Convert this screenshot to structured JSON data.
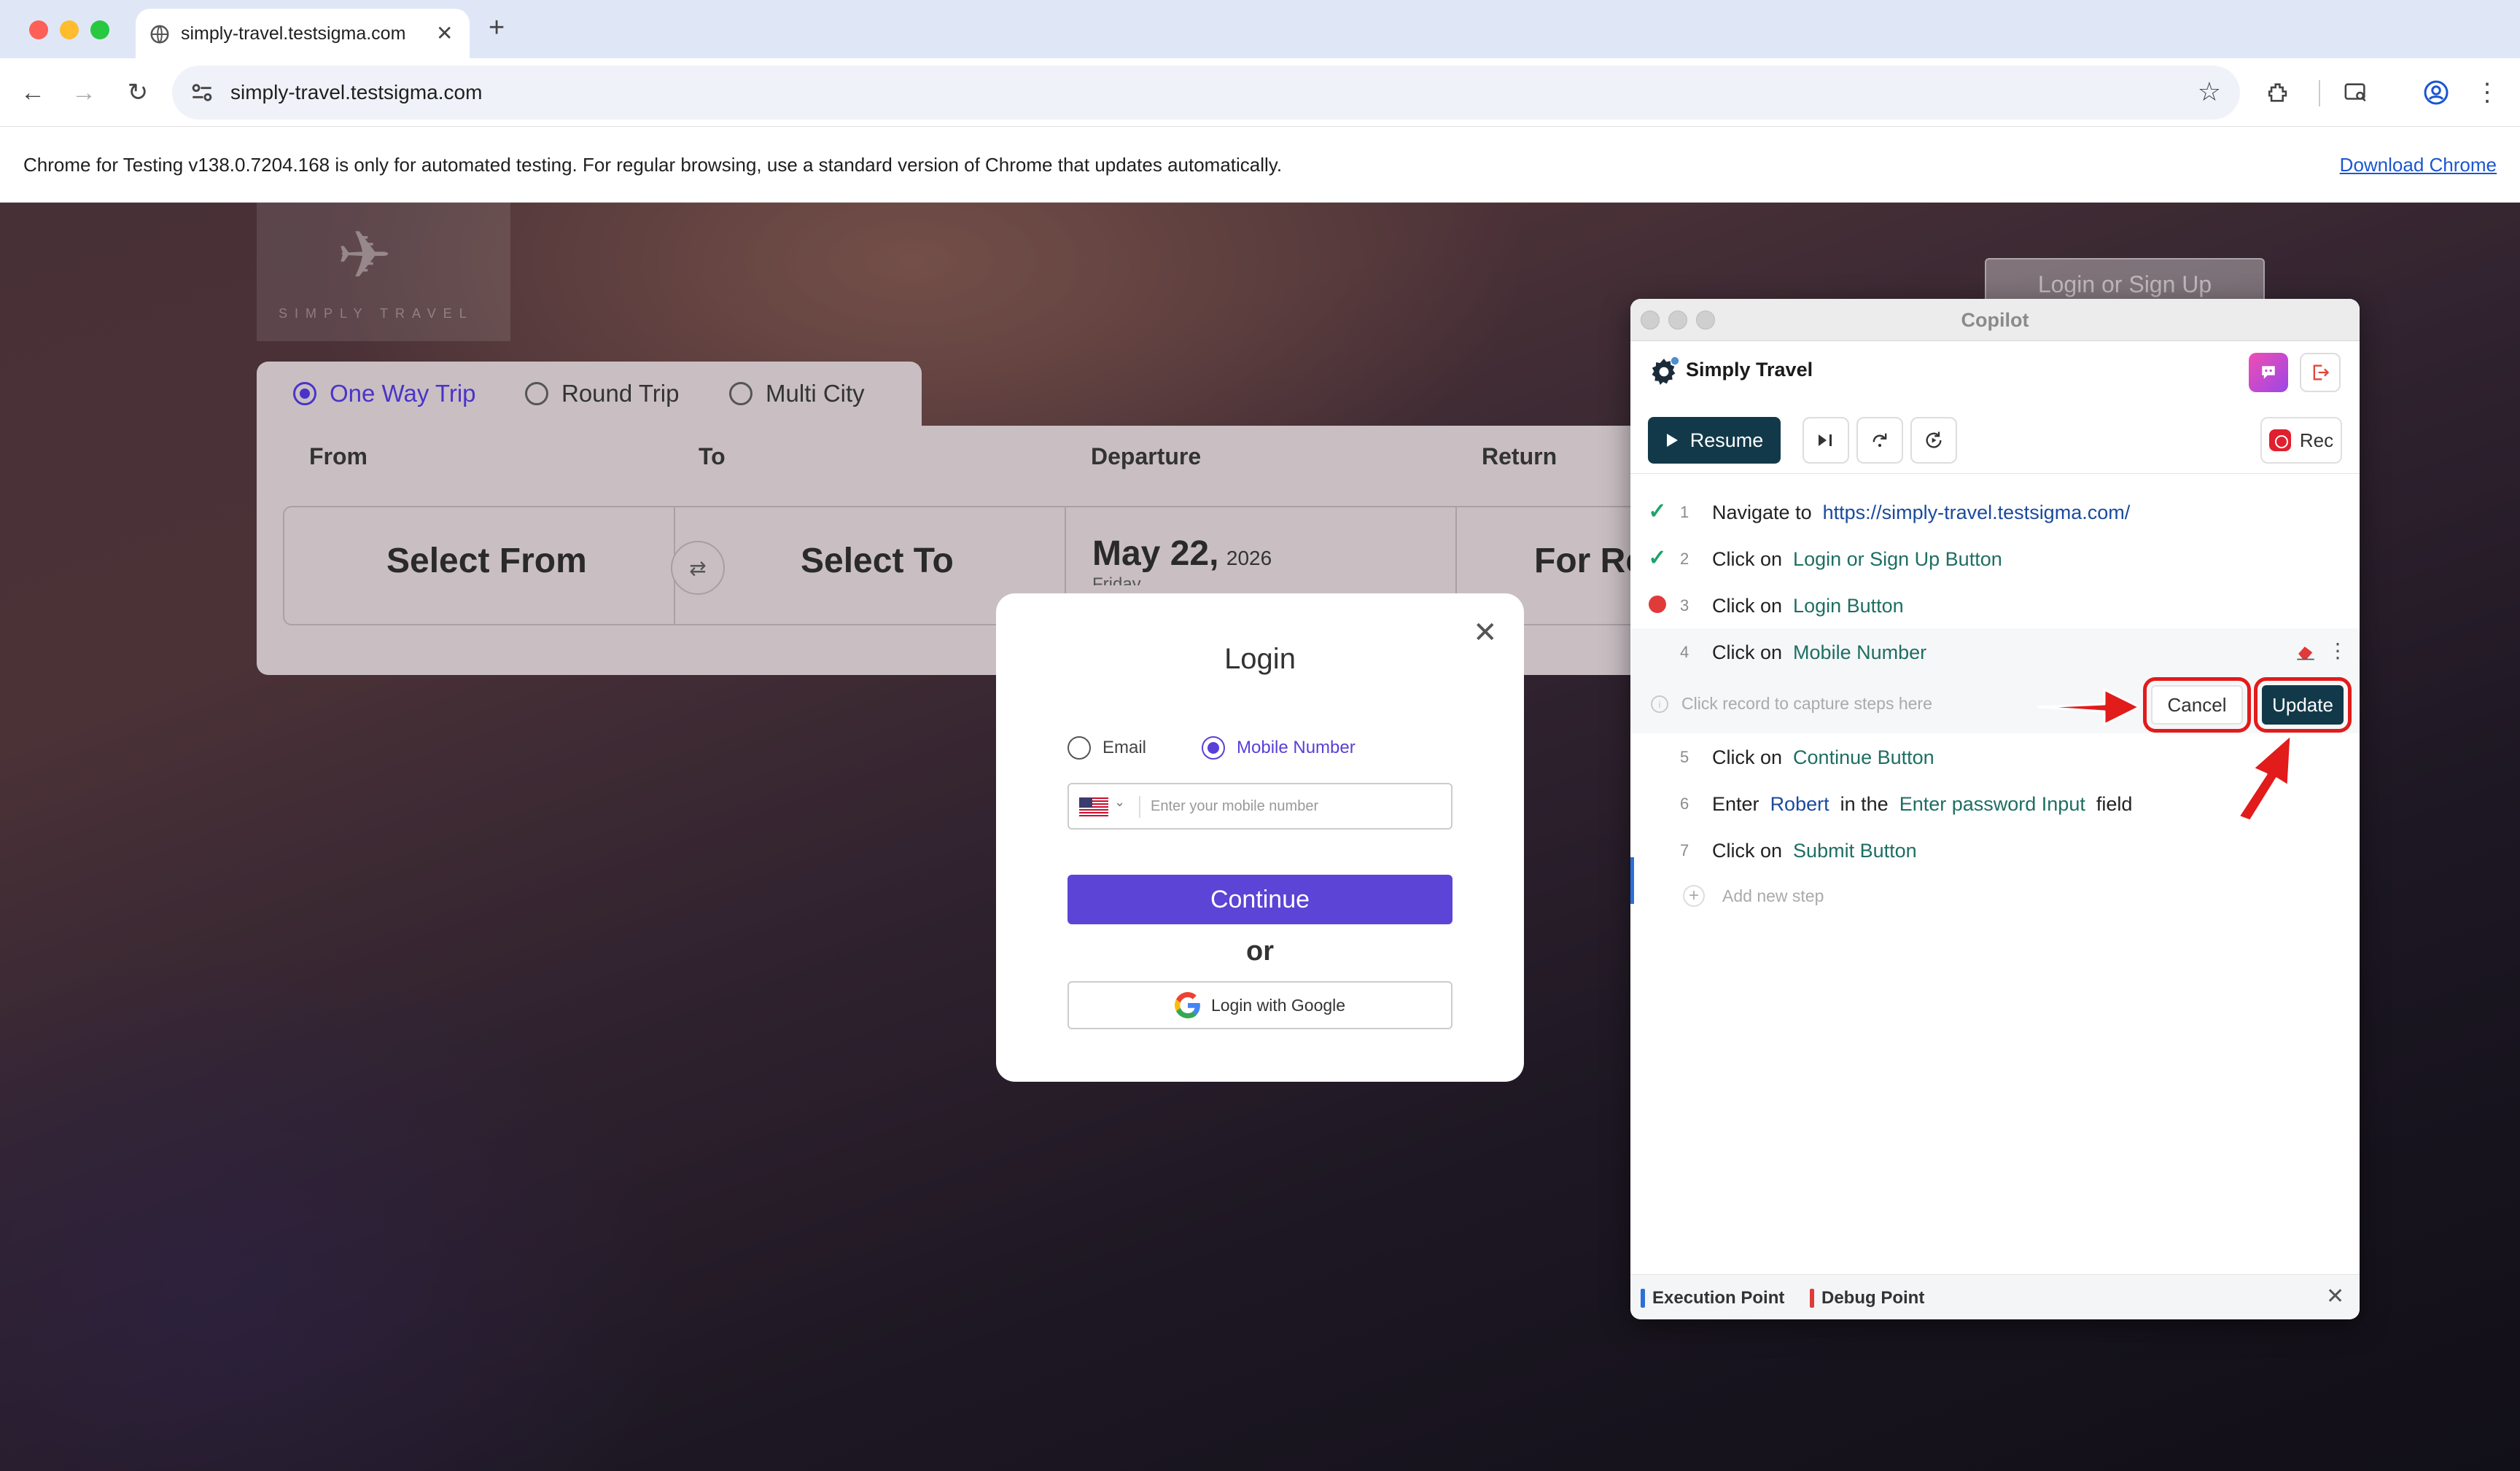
{
  "browser": {
    "tab_title": "simply-travel.testsigma.com",
    "url": "simply-travel.testsigma.com",
    "info_message": "Chrome for Testing v138.0.7204.168 is only for automated testing. For regular browsing, use a standard version of Chrome that updates automatically.",
    "download_link": "Download Chrome"
  },
  "site": {
    "login_signup": "Login or Sign Up",
    "trip_types": [
      "One Way Trip",
      "Round Trip",
      "Multi City"
    ],
    "selected_trip": "One Way Trip",
    "fields": {
      "from_label": "From",
      "to_label": "To",
      "departure_label": "Departure",
      "return_label": "Return",
      "from_value": "Select From",
      "to_value": "Select To",
      "departure_date": "May 22,",
      "departure_year": "2026",
      "departure_day": "Friday",
      "return_value": "For Re"
    }
  },
  "login_modal": {
    "title": "Login",
    "option_email": "Email",
    "option_mobile": "Mobile Number",
    "selected_option": "Mobile Number",
    "mobile_placeholder": "Enter your mobile number",
    "continue_label": "Continue",
    "or_label": "or",
    "google_label": "Login with Google"
  },
  "copilot": {
    "window_title": "Copilot",
    "app_name": "Simply Travel",
    "resume_label": "Resume",
    "rec_label": "Rec",
    "steps": [
      {
        "num": "1",
        "status": "passed",
        "action": "Navigate to",
        "target": "https://simply-travel.testsigma.com/"
      },
      {
        "num": "2",
        "status": "passed",
        "action": "Click on",
        "target": "Login or Sign Up Button"
      },
      {
        "num": "3",
        "status": "breakpoint",
        "action": "Click on",
        "target": "Login Button"
      },
      {
        "num": "4",
        "status": "editing",
        "action": "Click on",
        "target": "Mobile Number"
      },
      {
        "num": "5",
        "status": "pending",
        "action": "Click on",
        "target": "Continue Button"
      },
      {
        "num": "6",
        "status": "pending",
        "action": "Enter",
        "value": "Robert",
        "connector": "in the",
        "target": "Enter password Input",
        "suffix": "field"
      },
      {
        "num": "7",
        "status": "pending",
        "action": "Click on",
        "target": "Submit Button"
      }
    ],
    "record_hint": "Click record to capture steps here",
    "cancel_label": "Cancel",
    "update_label": "Update",
    "add_step_label": "Add new step",
    "legend": {
      "execution_point": "Execution Point",
      "debug_point": "Debug Point",
      "execution_color": "#2c6fd8",
      "debug_color": "#e03a3a"
    }
  },
  "colors": {
    "accent_purple": "#5b44d6",
    "copilot_primary": "#12394a",
    "annotation_red": "#e21b1b"
  }
}
